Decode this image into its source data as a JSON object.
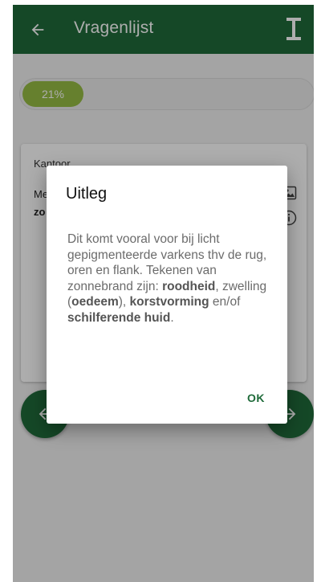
{
  "colors": {
    "primary": "#1f6b3a",
    "progress": "#97bd45",
    "scrim": "rgba(0,0,0,0.32)"
  },
  "appbar": {
    "title": "Vragenlijst",
    "back_icon": "arrow-left-icon",
    "cursor_icon": "text-cursor-icon"
  },
  "progress": {
    "label": "21%",
    "value": 0.21
  },
  "card": {
    "category": "Kantoor",
    "question_start": "Me",
    "question_bold": "zo",
    "image_icon": "image-icon",
    "info_icon": "info-icon"
  },
  "dialog": {
    "title": "Uitleg",
    "body_1": "Dit komt vooral voor bij licht gepigmenteerde varkens thv de rug, oren en flank. Tekenen van zonnebrand zijn: ",
    "bold_1": "roodheid",
    "body_2": ", zwelling (",
    "bold_2": "oedeem",
    "body_3": "), ",
    "bold_3": "korstvorming",
    "body_4": " en/of ",
    "bold_4": "schilferende huid",
    "body_5": ".",
    "ok_label": "OK"
  }
}
